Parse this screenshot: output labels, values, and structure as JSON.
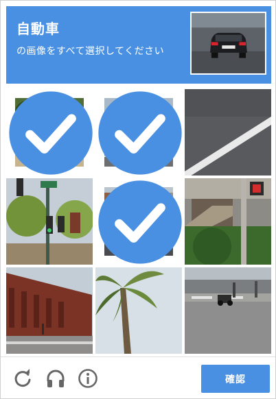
{
  "header": {
    "title": "自動車",
    "instruction": "の画像をすべて選択してください"
  },
  "grid": {
    "tiles": [
      {
        "scene": "park-car-red-canopy",
        "selected": true
      },
      {
        "scene": "road-white-car-grass",
        "selected": true
      },
      {
        "scene": "asphalt-white-line",
        "selected": false
      },
      {
        "scene": "traffic-light-street-sign",
        "selected": false
      },
      {
        "scene": "street-cars-buildings",
        "selected": true
      },
      {
        "scene": "pole-stairs-walk-signal",
        "selected": false
      },
      {
        "scene": "corner-brick-building",
        "selected": false
      },
      {
        "scene": "palm-tree-sky",
        "selected": false
      },
      {
        "scene": "crosswalk-motorbike-people",
        "selected": false
      }
    ]
  },
  "footer": {
    "reload_icon": "reload-icon",
    "audio_icon": "headphones-icon",
    "info_icon": "info-icon",
    "verify_label": "確認"
  },
  "colors": {
    "accent": "#4a90e2",
    "check": "#4a90e2",
    "icon_gray": "#666666"
  }
}
